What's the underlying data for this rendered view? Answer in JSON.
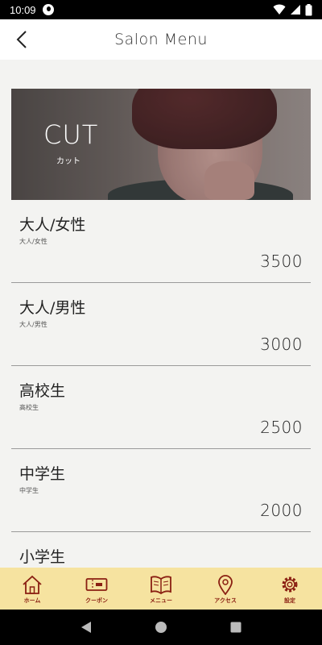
{
  "status_bar": {
    "time": "10:09"
  },
  "header": {
    "title": "Salon Menu"
  },
  "hero": {
    "title": "CUT",
    "subtitle": "カット"
  },
  "menu_items": [
    {
      "name": "大人/女性",
      "sub": "大人/女性",
      "price": "3500"
    },
    {
      "name": "大人/男性",
      "sub": "大人/男性",
      "price": "3000"
    },
    {
      "name": "高校生",
      "sub": "高校生",
      "price": "2500"
    },
    {
      "name": "中学生",
      "sub": "中学生",
      "price": "2000"
    },
    {
      "name": "小学生",
      "sub": "",
      "price": ""
    }
  ],
  "tabs": [
    {
      "label": "ホーム",
      "icon": "home-icon"
    },
    {
      "label": "クーポン",
      "icon": "ticket-icon"
    },
    {
      "label": "メニュー",
      "icon": "book-icon"
    },
    {
      "label": "アクセス",
      "icon": "location-pin-icon"
    },
    {
      "label": "設定",
      "icon": "gear-icon"
    }
  ],
  "colors": {
    "tab_bar_bg": "#f6e3a0",
    "tab_accent": "#8a1f12",
    "page_bg": "#f3f3f1"
  }
}
